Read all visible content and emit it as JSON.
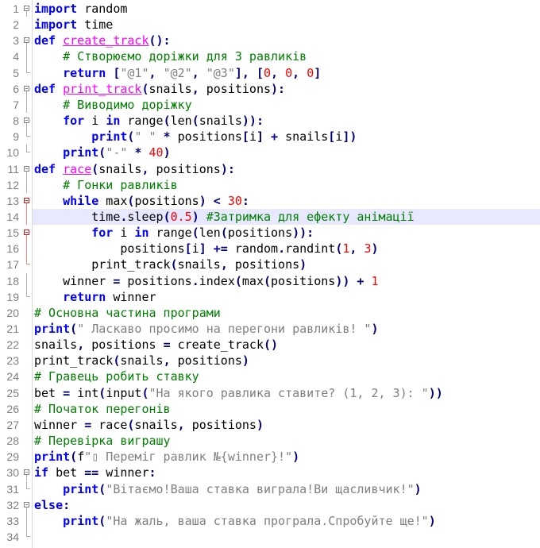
{
  "editor": {
    "current_line": 14,
    "colors": {
      "keyword": "#0000ff",
      "function_def": "#ff00ff",
      "comment": "#008000",
      "string": "#808080",
      "number": "#ff0000",
      "operator": "#000080",
      "current_line_bg": "#e8e8ff"
    },
    "lines": [
      {
        "n": "1",
        "fold": "box",
        "tokens": [
          [
            "kw",
            "import"
          ],
          [
            "tx",
            " random"
          ]
        ]
      },
      {
        "n": "2",
        "fold": "",
        "tokens": [
          [
            "kw",
            "import"
          ],
          [
            "tx",
            " time"
          ]
        ]
      },
      {
        "n": "3",
        "fold": "box",
        "tokens": [
          [
            "kw",
            "def"
          ],
          [
            "tx",
            " "
          ],
          [
            "fn",
            "create_track"
          ],
          [
            "op",
            "():"
          ]
        ]
      },
      {
        "n": "4",
        "fold": "line",
        "tokens": [
          [
            "tx",
            "    "
          ],
          [
            "cm",
            "# Створюємо доріжки для 3 равликів"
          ]
        ]
      },
      {
        "n": "5",
        "fold": "end",
        "tokens": [
          [
            "tx",
            "    "
          ],
          [
            "kw",
            "return"
          ],
          [
            "tx",
            " "
          ],
          [
            "op",
            "["
          ],
          [
            "st",
            "\"@1\""
          ],
          [
            "op",
            ", "
          ],
          [
            "st",
            "\"@2\""
          ],
          [
            "op",
            ", "
          ],
          [
            "st",
            "\"@3\""
          ],
          [
            "op",
            "], ["
          ],
          [
            "nm",
            "0"
          ],
          [
            "op",
            ", "
          ],
          [
            "nm",
            "0"
          ],
          [
            "op",
            ", "
          ],
          [
            "nm",
            "0"
          ],
          [
            "op",
            "]"
          ]
        ]
      },
      {
        "n": "6",
        "fold": "box",
        "tokens": [
          [
            "kw",
            "def"
          ],
          [
            "tx",
            " "
          ],
          [
            "fn",
            "print_track"
          ],
          [
            "op",
            "("
          ],
          [
            "tx",
            "snails"
          ],
          [
            "op",
            ", "
          ],
          [
            "tx",
            "positions"
          ],
          [
            "op",
            "):"
          ]
        ]
      },
      {
        "n": "7",
        "fold": "line",
        "tokens": [
          [
            "tx",
            "    "
          ],
          [
            "cm",
            "# Виводимо доріжку"
          ]
        ]
      },
      {
        "n": "8",
        "fold": "box",
        "tokens": [
          [
            "tx",
            "    "
          ],
          [
            "kw",
            "for"
          ],
          [
            "tx",
            " i "
          ],
          [
            "kw",
            "in"
          ],
          [
            "tx",
            " range"
          ],
          [
            "op",
            "("
          ],
          [
            "tx",
            "len"
          ],
          [
            "op",
            "("
          ],
          [
            "tx",
            "snails"
          ],
          [
            "op",
            ")):"
          ]
        ]
      },
      {
        "n": "9",
        "fold": "end",
        "tokens": [
          [
            "tx",
            "        "
          ],
          [
            "kw",
            "print"
          ],
          [
            "op",
            "("
          ],
          [
            "st",
            "\" \""
          ],
          [
            "tx",
            " "
          ],
          [
            "op",
            "*"
          ],
          [
            "tx",
            " positions"
          ],
          [
            "op",
            "["
          ],
          [
            "tx",
            "i"
          ],
          [
            "op",
            "]"
          ],
          [
            "tx",
            " "
          ],
          [
            "op",
            "+"
          ],
          [
            "tx",
            " snails"
          ],
          [
            "op",
            "["
          ],
          [
            "tx",
            "i"
          ],
          [
            "op",
            "])"
          ]
        ]
      },
      {
        "n": "10",
        "fold": "end",
        "tokens": [
          [
            "tx",
            "    "
          ],
          [
            "kw",
            "print"
          ],
          [
            "op",
            "("
          ],
          [
            "st",
            "\"-\""
          ],
          [
            "tx",
            " "
          ],
          [
            "op",
            "*"
          ],
          [
            "tx",
            " "
          ],
          [
            "nm",
            "40"
          ],
          [
            "op",
            ")"
          ]
        ]
      },
      {
        "n": "11",
        "fold": "box",
        "tokens": [
          [
            "kw",
            "def"
          ],
          [
            "tx",
            " "
          ],
          [
            "fn",
            "race"
          ],
          [
            "op",
            "("
          ],
          [
            "tx",
            "snails"
          ],
          [
            "op",
            ", "
          ],
          [
            "tx",
            "positions"
          ],
          [
            "op",
            "):"
          ]
        ]
      },
      {
        "n": "12",
        "fold": "line",
        "tokens": [
          [
            "tx",
            "    "
          ],
          [
            "cm",
            "# Гонки равликів"
          ]
        ]
      },
      {
        "n": "13",
        "fold": "redbox",
        "tokens": [
          [
            "tx",
            "    "
          ],
          [
            "kw",
            "while"
          ],
          [
            "tx",
            " max"
          ],
          [
            "op",
            "("
          ],
          [
            "tx",
            "positions"
          ],
          [
            "op",
            ")"
          ],
          [
            "tx",
            " "
          ],
          [
            "op",
            "<"
          ],
          [
            "tx",
            " "
          ],
          [
            "nm",
            "30"
          ],
          [
            "op",
            ":"
          ]
        ]
      },
      {
        "n": "14",
        "fold": "redline",
        "tokens": [
          [
            "tx",
            "        time"
          ],
          [
            "op",
            "."
          ],
          [
            "tx",
            "sleep"
          ],
          [
            "op",
            "("
          ],
          [
            "nm",
            "0.5"
          ],
          [
            "op",
            ")"
          ],
          [
            "tx",
            " "
          ],
          [
            "cm",
            "#Затримка для ефекту анімації"
          ]
        ]
      },
      {
        "n": "15",
        "fold": "redbox",
        "tokens": [
          [
            "tx",
            "        "
          ],
          [
            "kw",
            "for"
          ],
          [
            "tx",
            " i "
          ],
          [
            "kw",
            "in"
          ],
          [
            "tx",
            " range"
          ],
          [
            "op",
            "("
          ],
          [
            "tx",
            "len"
          ],
          [
            "op",
            "("
          ],
          [
            "tx",
            "positions"
          ],
          [
            "op",
            ")):"
          ]
        ]
      },
      {
        "n": "16",
        "fold": "redline",
        "tokens": [
          [
            "tx",
            "            positions"
          ],
          [
            "op",
            "["
          ],
          [
            "tx",
            "i"
          ],
          [
            "op",
            "]"
          ],
          [
            "tx",
            " "
          ],
          [
            "op",
            "+="
          ],
          [
            "tx",
            " random"
          ],
          [
            "op",
            "."
          ],
          [
            "tx",
            "randint"
          ],
          [
            "op",
            "("
          ],
          [
            "nm",
            "1"
          ],
          [
            "op",
            ", "
          ],
          [
            "nm",
            "3"
          ],
          [
            "op",
            ")"
          ]
        ]
      },
      {
        "n": "17",
        "fold": "redend",
        "tokens": [
          [
            "tx",
            "        print_track"
          ],
          [
            "op",
            "("
          ],
          [
            "tx",
            "snails"
          ],
          [
            "op",
            ", "
          ],
          [
            "tx",
            "positions"
          ],
          [
            "op",
            ")"
          ]
        ]
      },
      {
        "n": "18",
        "fold": "line",
        "tokens": [
          [
            "tx",
            "    winner "
          ],
          [
            "op",
            "="
          ],
          [
            "tx",
            " positions"
          ],
          [
            "op",
            "."
          ],
          [
            "tx",
            "index"
          ],
          [
            "op",
            "("
          ],
          [
            "tx",
            "max"
          ],
          [
            "op",
            "("
          ],
          [
            "tx",
            "positions"
          ],
          [
            "op",
            "))"
          ],
          [
            "tx",
            " "
          ],
          [
            "op",
            "+"
          ],
          [
            "tx",
            " "
          ],
          [
            "nm",
            "1"
          ]
        ]
      },
      {
        "n": "19",
        "fold": "end",
        "tokens": [
          [
            "tx",
            "    "
          ],
          [
            "kw",
            "return"
          ],
          [
            "tx",
            " winner"
          ]
        ]
      },
      {
        "n": "20",
        "fold": "",
        "tokens": [
          [
            "cm",
            "# Основна частина програми"
          ]
        ]
      },
      {
        "n": "21",
        "fold": "",
        "tokens": [
          [
            "kw",
            "print"
          ],
          [
            "op",
            "("
          ],
          [
            "st",
            "\" Ласкаво просимо на перегони равликів! \""
          ],
          [
            "op",
            ")"
          ]
        ]
      },
      {
        "n": "22",
        "fold": "",
        "tokens": [
          [
            "tx",
            "snails"
          ],
          [
            "op",
            ", "
          ],
          [
            "tx",
            "positions "
          ],
          [
            "op",
            "="
          ],
          [
            "tx",
            " create_track"
          ],
          [
            "op",
            "()"
          ]
        ]
      },
      {
        "n": "23",
        "fold": "",
        "tokens": [
          [
            "tx",
            "print_track"
          ],
          [
            "op",
            "("
          ],
          [
            "tx",
            "snails"
          ],
          [
            "op",
            ", "
          ],
          [
            "tx",
            "positions"
          ],
          [
            "op",
            ")"
          ]
        ]
      },
      {
        "n": "24",
        "fold": "",
        "tokens": [
          [
            "cm",
            "# Гравець робить ставку"
          ]
        ]
      },
      {
        "n": "25",
        "fold": "",
        "tokens": [
          [
            "tx",
            "bet "
          ],
          [
            "op",
            "="
          ],
          [
            "tx",
            " int"
          ],
          [
            "op",
            "("
          ],
          [
            "tx",
            "input"
          ],
          [
            "op",
            "("
          ],
          [
            "st",
            "\"На якого равлика ставите? (1, 2, 3): \""
          ],
          [
            "op",
            "))"
          ]
        ]
      },
      {
        "n": "26",
        "fold": "",
        "tokens": [
          [
            "cm",
            "# Початок перегонів"
          ]
        ]
      },
      {
        "n": "27",
        "fold": "",
        "tokens": [
          [
            "tx",
            "winner "
          ],
          [
            "op",
            "="
          ],
          [
            "tx",
            " race"
          ],
          [
            "op",
            "("
          ],
          [
            "tx",
            "snails"
          ],
          [
            "op",
            ", "
          ],
          [
            "tx",
            "positions"
          ],
          [
            "op",
            ")"
          ]
        ]
      },
      {
        "n": "28",
        "fold": "",
        "tokens": [
          [
            "cm",
            "# Перевірка виграшу"
          ]
        ]
      },
      {
        "n": "29",
        "fold": "",
        "tokens": [
          [
            "kw",
            "print"
          ],
          [
            "op",
            "("
          ],
          [
            "tx",
            "f"
          ],
          [
            "st",
            "\"▯ Переміг равлик №{winner}!\""
          ],
          [
            "op",
            ")"
          ]
        ]
      },
      {
        "n": "30",
        "fold": "box",
        "tokens": [
          [
            "kw",
            "if"
          ],
          [
            "tx",
            " bet "
          ],
          [
            "op",
            "=="
          ],
          [
            "tx",
            " winner"
          ],
          [
            "op",
            ":"
          ]
        ]
      },
      {
        "n": "31",
        "fold": "end",
        "tokens": [
          [
            "tx",
            "    "
          ],
          [
            "kw",
            "print"
          ],
          [
            "op",
            "("
          ],
          [
            "st",
            "\"Вітаємо!Ваша ставка виграла!Ви щасливчик!\""
          ],
          [
            "op",
            ")"
          ]
        ]
      },
      {
        "n": "32",
        "fold": "box",
        "tokens": [
          [
            "kw",
            "else"
          ],
          [
            "op",
            ":"
          ]
        ]
      },
      {
        "n": "33",
        "fold": "line",
        "tokens": [
          [
            "tx",
            "    "
          ],
          [
            "kw",
            "print"
          ],
          [
            "op",
            "("
          ],
          [
            "st",
            "\"На жаль, ваша ставка програла.Спробуйте ще!\""
          ],
          [
            "op",
            ")"
          ]
        ]
      },
      {
        "n": "34",
        "fold": "end",
        "tokens": []
      }
    ]
  }
}
